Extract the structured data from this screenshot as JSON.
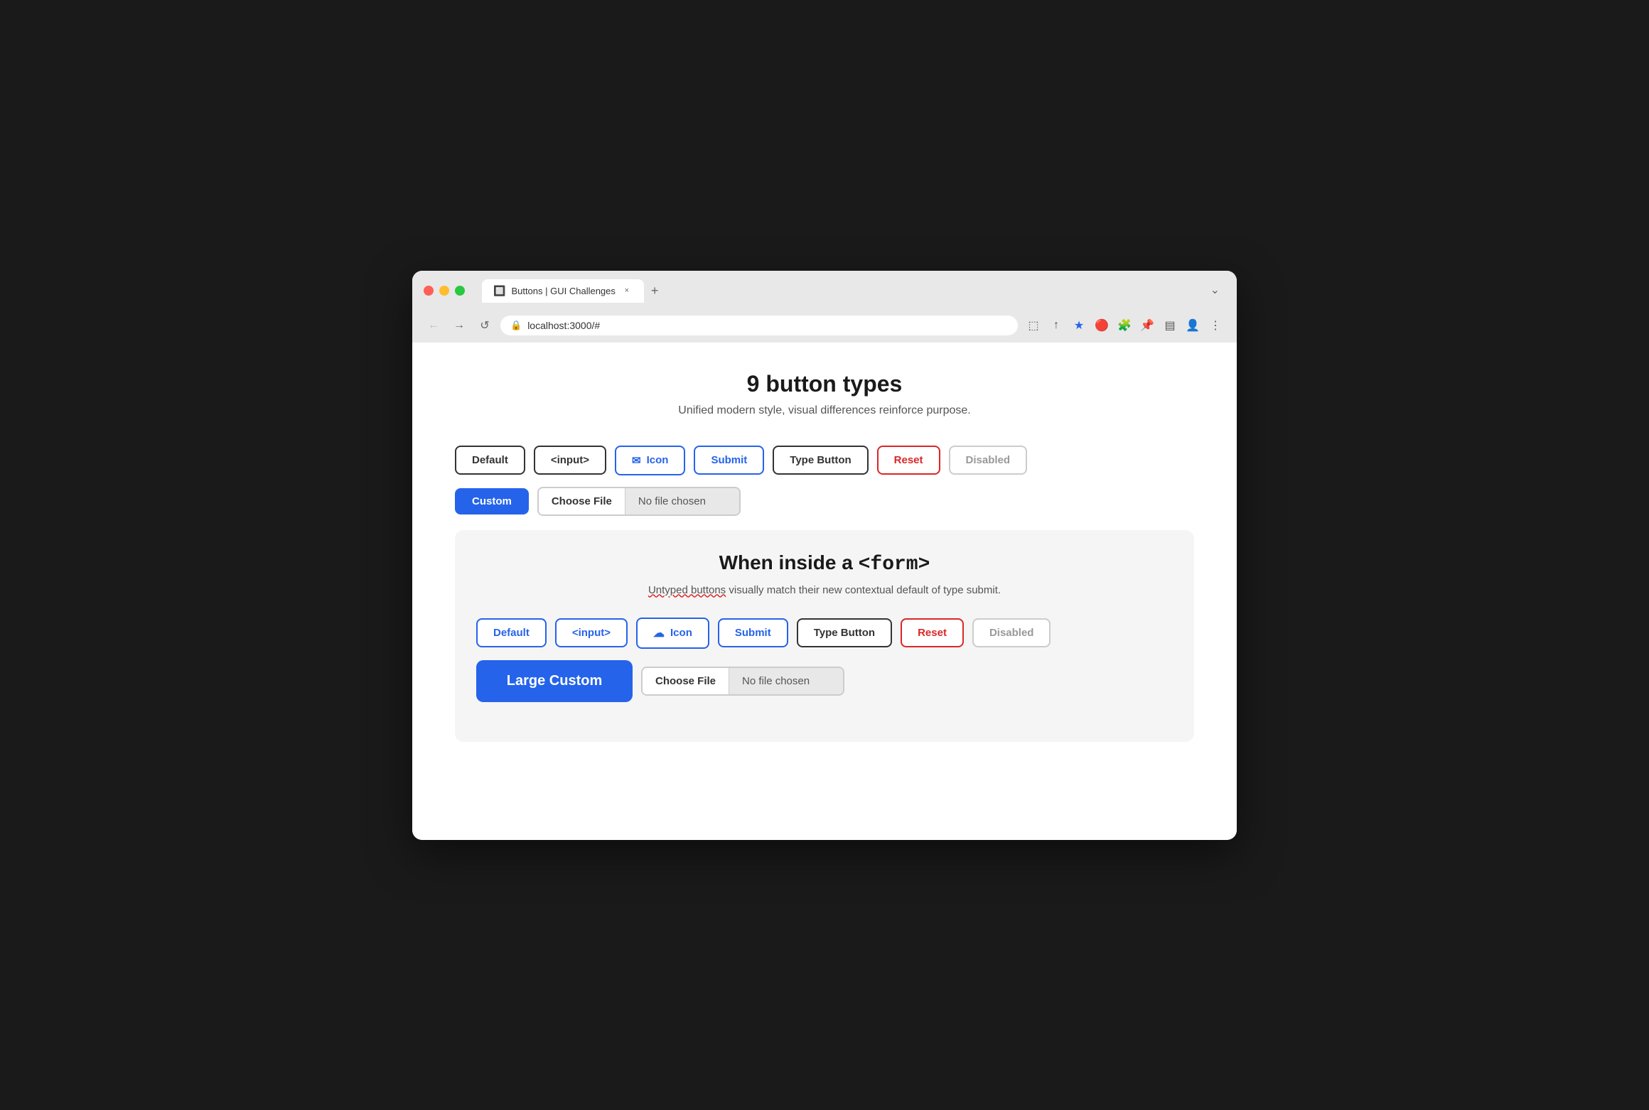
{
  "browser": {
    "controls": {
      "close_label": "×",
      "minimize_label": "−",
      "maximize_label": "+"
    },
    "tab": {
      "title": "Buttons | GUI Challenges",
      "favicon": "🔲",
      "close_icon": "×"
    },
    "new_tab_icon": "+",
    "expand_icon": "⌄",
    "nav": {
      "back_icon": "←",
      "forward_icon": "→",
      "refresh_icon": "↺",
      "url": "localhost:3000/#"
    },
    "toolbar": {
      "external_link_icon": "⬚",
      "share_icon": "↑",
      "star_icon": "★",
      "extension1_icon": "🔴",
      "puzzle_icon": "🧩",
      "pin_icon": "📌",
      "sidebar_icon": "▤",
      "profile_icon": "👤",
      "menu_icon": "⋮"
    }
  },
  "page": {
    "title": "9 button types",
    "subtitle": "Unified modern style, visual differences reinforce purpose.",
    "buttons_row1": [
      {
        "label": "Default",
        "type": "default"
      },
      {
        "label": "<input>",
        "type": "default"
      },
      {
        "label": "Icon",
        "type": "icon",
        "icon": "✉"
      },
      {
        "label": "Submit",
        "type": "submit"
      },
      {
        "label": "Type Button",
        "type": "type-button"
      },
      {
        "label": "Reset",
        "type": "reset"
      },
      {
        "label": "Disabled",
        "type": "disabled"
      }
    ],
    "buttons_row2": [
      {
        "label": "Custom",
        "type": "custom"
      }
    ],
    "file_input": {
      "choose_label": "Choose File",
      "no_file_label": "No file chosen"
    },
    "form_section": {
      "title_text": "When inside a ",
      "title_code": "<form>",
      "subtitle_plain": " visually match their new contextual default of type submit.",
      "subtitle_underline": "Untyped buttons",
      "buttons_row1": [
        {
          "label": "Default",
          "type": "form-default"
        },
        {
          "label": "<input>",
          "type": "form-default"
        },
        {
          "label": "Icon",
          "type": "form-icon",
          "icon": "☁"
        },
        {
          "label": "Submit",
          "type": "form-submit"
        },
        {
          "label": "Type Button",
          "type": "form-type-button"
        },
        {
          "label": "Reset",
          "type": "form-reset"
        },
        {
          "label": "Disabled",
          "type": "form-disabled"
        }
      ],
      "large_custom_label": "Large Custom",
      "file_input": {
        "choose_label": "Choose File",
        "no_file_label": "No file chosen"
      }
    }
  }
}
